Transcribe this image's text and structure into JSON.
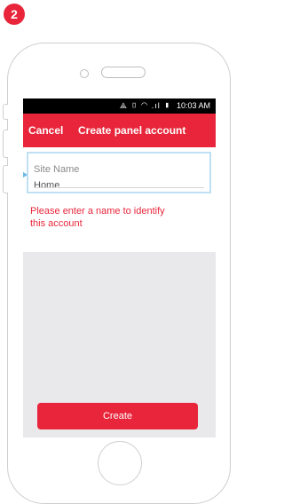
{
  "step_badge": "2",
  "status_bar": {
    "icons": "⟁ ▯ ◠ .ıl ▮",
    "time": "10:03 AM"
  },
  "app_bar": {
    "cancel_label": "Cancel",
    "title": "Create panel account"
  },
  "form": {
    "site_name_label": "Site Name",
    "site_name_value": "Home",
    "helper_text": "Please enter a name to identify this account"
  },
  "footer": {
    "create_label": "Create"
  },
  "colors": {
    "accent": "#e8253a",
    "field_highlight": "#bfe0f3"
  },
  "icons": [
    "vibrate-icon",
    "wifi-icon",
    "signal-icon",
    "battery-icon",
    "field-pointer-arrow-icon"
  ]
}
